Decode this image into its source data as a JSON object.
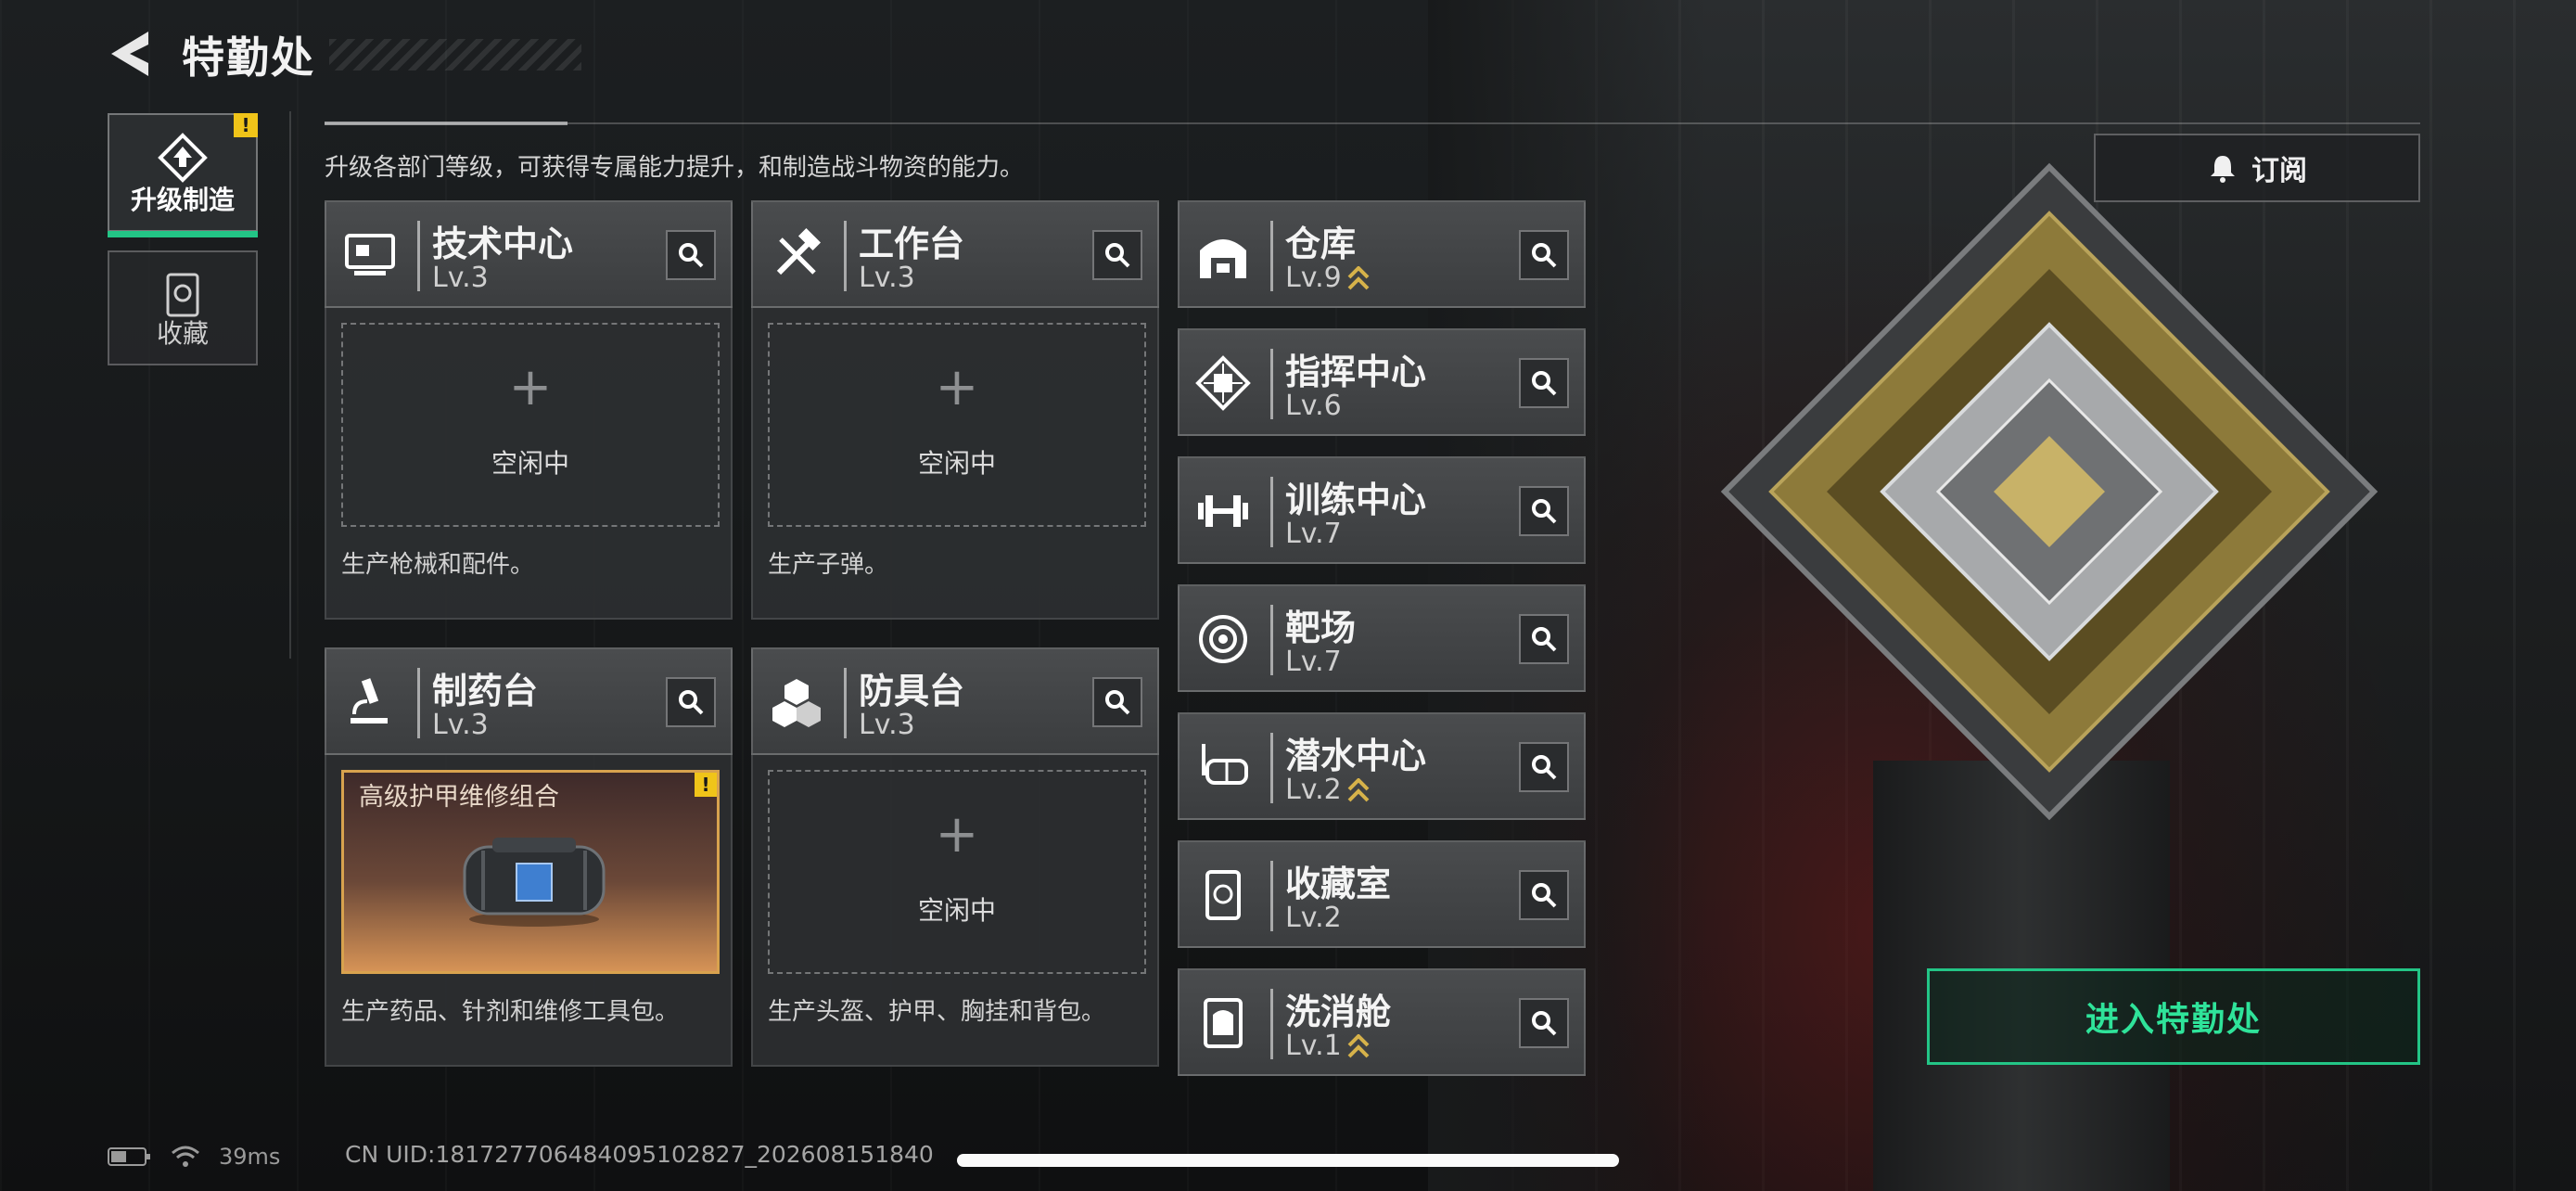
{
  "header": {
    "title": "特勤处"
  },
  "tabs": [
    {
      "label": "升级制造",
      "alert": "!"
    },
    {
      "label": "收藏"
    }
  ],
  "intro": "升级各部门等级，可获得专属能力提升，和制造战斗物资的能力。",
  "subscribe": {
    "label": "订阅"
  },
  "workshops": [
    {
      "name": "技术中心",
      "level": "Lv.3",
      "slot": {
        "plus": "+",
        "status": "空闲中"
      },
      "desc": "生产枪械和配件。"
    },
    {
      "name": "工作台",
      "level": "Lv.3",
      "slot": {
        "plus": "+",
        "status": "空闲中"
      },
      "desc": "生产子弹。"
    },
    {
      "name": "制药台",
      "level": "Lv.3",
      "craft": {
        "item": "高级护甲维修组合",
        "alert": "!"
      },
      "desc": "生产药品、针剂和维修工具包。"
    },
    {
      "name": "防具台",
      "level": "Lv.3",
      "slot": {
        "plus": "+",
        "status": "空闲中"
      },
      "desc": "生产头盔、护甲、胸挂和背包。"
    }
  ],
  "departments": [
    {
      "name": "仓库",
      "level": "Lv.9",
      "upgradable": true
    },
    {
      "name": "指挥中心",
      "level": "Lv.6",
      "upgradable": false
    },
    {
      "name": "训练中心",
      "level": "Lv.7",
      "upgradable": false
    },
    {
      "name": "靶场",
      "level": "Lv.7",
      "upgradable": false
    },
    {
      "name": "潜水中心",
      "level": "Lv.2",
      "upgradable": true
    },
    {
      "name": "收藏室",
      "level": "Lv.2",
      "upgradable": false
    },
    {
      "name": "洗消舱",
      "level": "Lv.1",
      "upgradable": true
    }
  ],
  "enter_button": {
    "label": "进入特勤处"
  },
  "footer": {
    "ping": "39ms",
    "uid": "CN UID:18172770648409510282​7_202608151840"
  },
  "colors": {
    "accent": "#23c586",
    "alert": "#f0c419",
    "upgrade": "#d6b24a"
  }
}
